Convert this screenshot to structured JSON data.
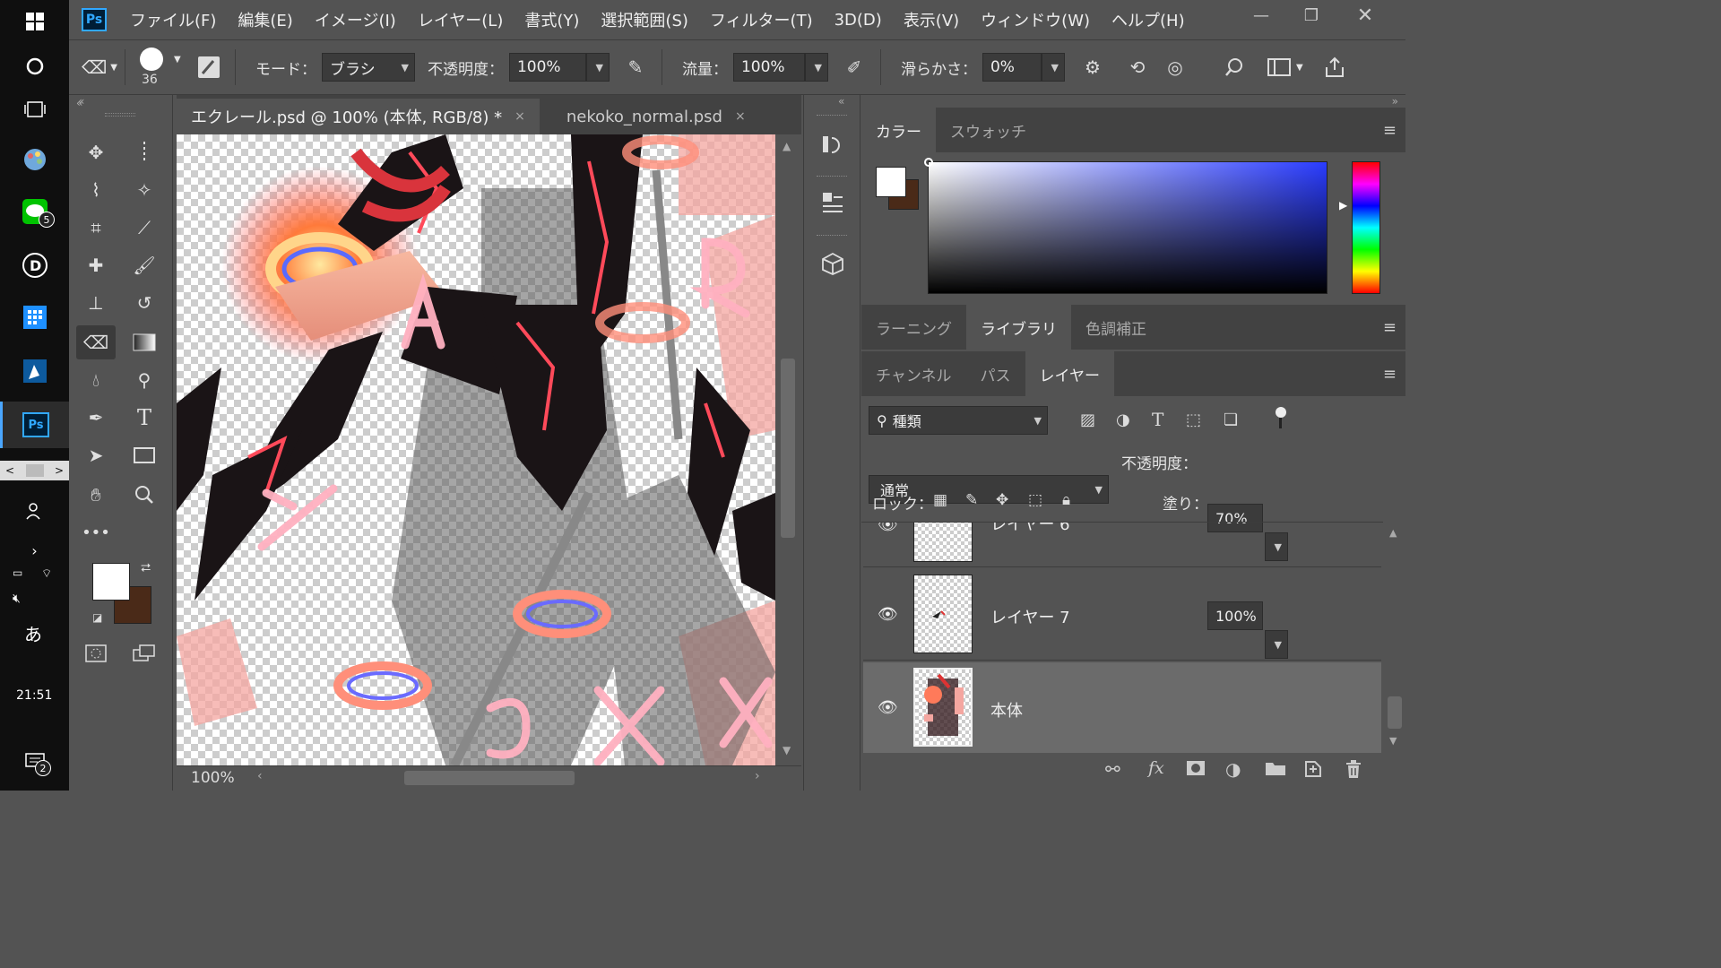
{
  "taskbar": {
    "time": "21:51",
    "ime": "あ",
    "line_badge": "5",
    "notify_badge": "2",
    "ps_label": "Ps"
  },
  "app": {
    "logo": "Ps",
    "menu": [
      "ファイル(F)",
      "編集(E)",
      "イメージ(I)",
      "レイヤー(L)",
      "書式(Y)",
      "選択範囲(S)",
      "フィルター(T)",
      "3D(D)",
      "表示(V)",
      "ウィンドウ(W)",
      "ヘルプ(H)"
    ]
  },
  "options": {
    "brush_size": "36",
    "mode_label": "モード：",
    "mode_value": "ブラシ",
    "opacity_label": "不透明度：",
    "opacity_value": "100%",
    "flow_label": "流量：",
    "flow_value": "100%",
    "smoothing_label": "滑らかさ：",
    "smoothing_value": "0%"
  },
  "tabs": [
    {
      "label": "エクレール.psd @ 100% (本体, RGB/8) *",
      "close": "×"
    },
    {
      "label": "nekoko_normal.psd",
      "close": "×"
    }
  ],
  "status": {
    "zoom": "100%"
  },
  "panels": {
    "color_tabs": [
      "カラー",
      "スウォッチ"
    ],
    "lib_tabs": [
      "ラーニング",
      "ライブラリ",
      "色調補正"
    ],
    "layer_tabs": [
      "チャンネル",
      "パス",
      "レイヤー"
    ],
    "filter_label": "種類",
    "blend_mode": "通常",
    "opacity_label": "不透明度：",
    "opacity_value": "70%",
    "lock_label": "ロック：",
    "fill_label": "塗り：",
    "fill_value": "100%"
  },
  "layers": [
    {
      "name": "レイヤー 6"
    },
    {
      "name": "レイヤー 7"
    },
    {
      "name": "本体"
    }
  ],
  "colors": {
    "foreground": "#ffffff",
    "background": "#4a2a18",
    "accent": "#31a8ff"
  }
}
